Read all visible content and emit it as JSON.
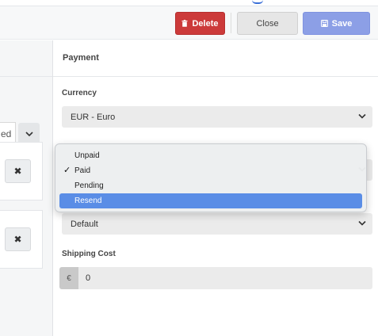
{
  "toolbar": {
    "delete_label": "Delete",
    "close_label": "Close",
    "save_label": "Save",
    "delete_color": "#cc3a3a",
    "save_color": "#8c9fe6"
  },
  "left_panel": {
    "partial_text": "ed",
    "remove_glyph": "✖"
  },
  "panel": {
    "title": "Payment",
    "currency_label": "Currency",
    "currency_value": "EUR - Euro",
    "third_select_value": "Default",
    "shipping_label": "Shipping Cost",
    "shipping_prefix": "€",
    "shipping_value": "0"
  },
  "payment_status_dropdown": {
    "options": [
      "Unpaid",
      "Paid",
      "Pending",
      "Resend"
    ],
    "checked": "Paid",
    "highlighted": "Resend",
    "check_glyph": "✓",
    "highlight_color": "#5a8de6"
  }
}
